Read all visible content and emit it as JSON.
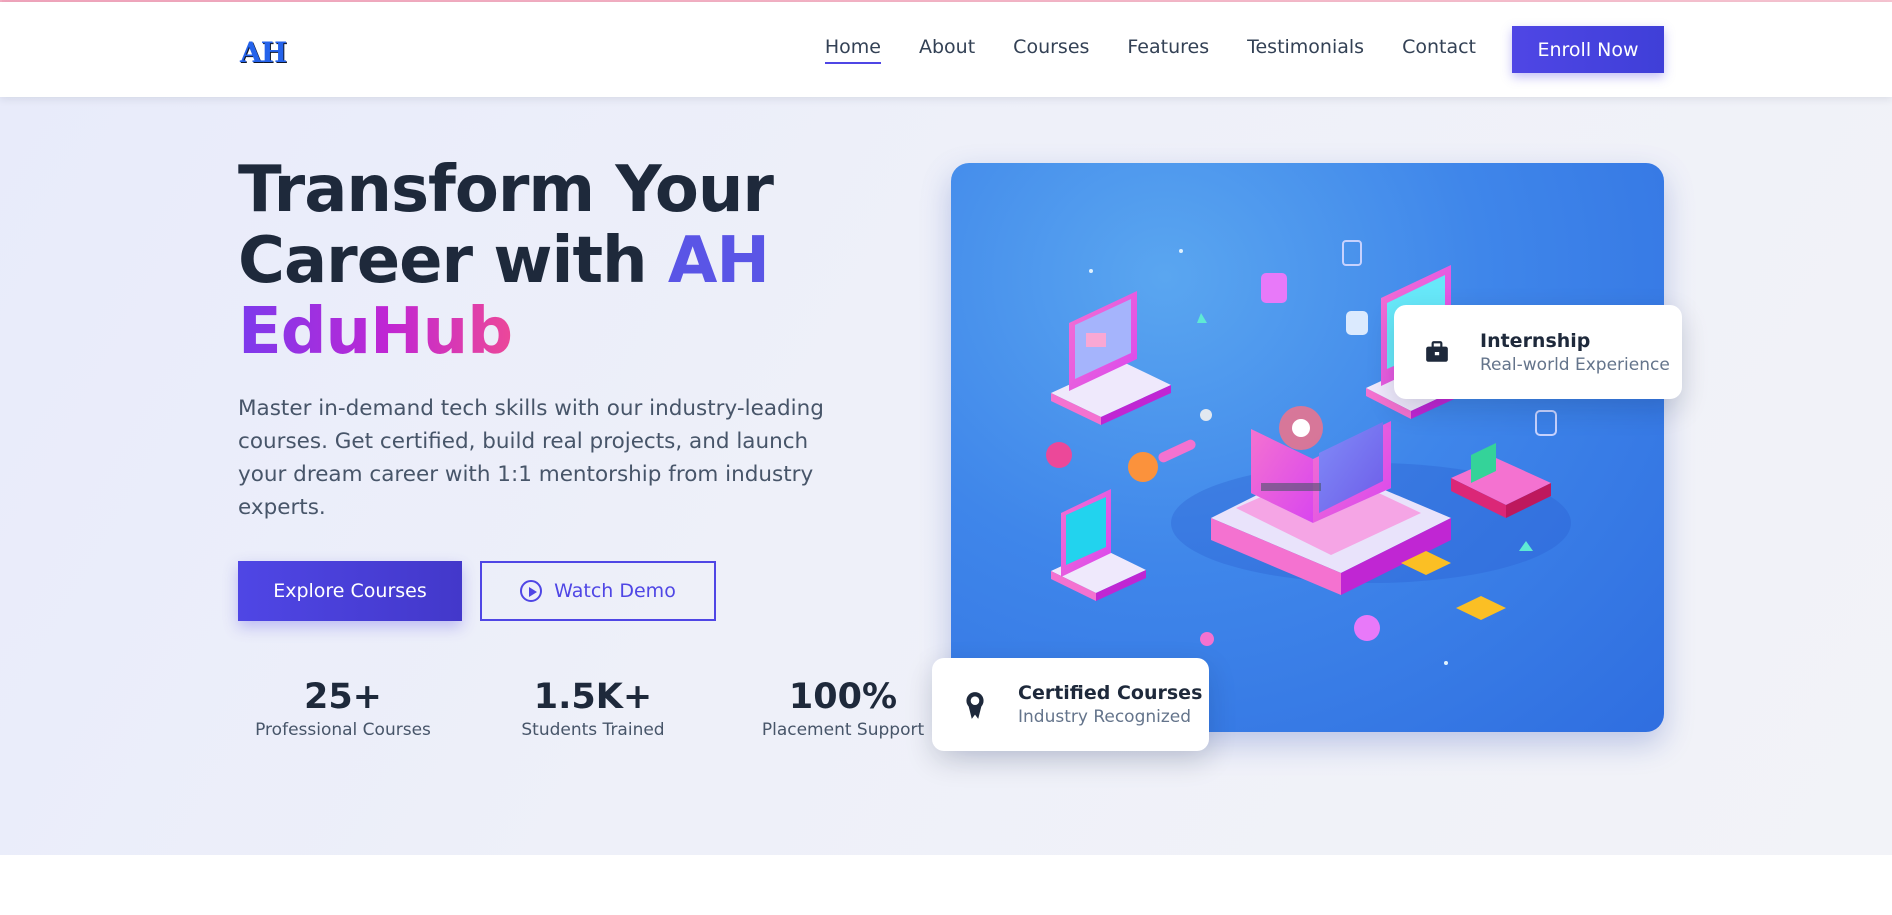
{
  "header": {
    "logo_text": "AH",
    "nav": [
      {
        "label": "Home",
        "active": true
      },
      {
        "label": "About"
      },
      {
        "label": "Courses"
      },
      {
        "label": "Features"
      },
      {
        "label": "Testimonials"
      },
      {
        "label": "Contact"
      }
    ],
    "enroll_label": "Enroll Now"
  },
  "hero": {
    "title_line1": "Transform Your",
    "title_line2a": "Career with ",
    "title_line2b": "AH",
    "title_line3": "EduHub",
    "description": "Master in-demand tech skills with our industry-leading courses. Get certified, build real projects, and launch your dream career with 1:1 mentorship from industry experts.",
    "explore_label": "Explore Courses",
    "demo_label": "Watch Demo",
    "stats": [
      {
        "value": "25+",
        "label": "Professional Courses"
      },
      {
        "value": "1.5K+",
        "label": "Students Trained"
      },
      {
        "value": "100%",
        "label": "Placement Support"
      }
    ]
  },
  "cards": {
    "internship": {
      "title": "Internship",
      "subtitle": "Real-world Experience",
      "icon": "briefcase-icon"
    },
    "certified": {
      "title": "Certified Courses",
      "subtitle": "Industry Recognized",
      "icon": "award-icon"
    }
  },
  "colors": {
    "accent": "#4f46e5",
    "gradient_start": "#7c3aed",
    "gradient_end": "#ec4899",
    "illustration_bg": "#3f86ea"
  }
}
